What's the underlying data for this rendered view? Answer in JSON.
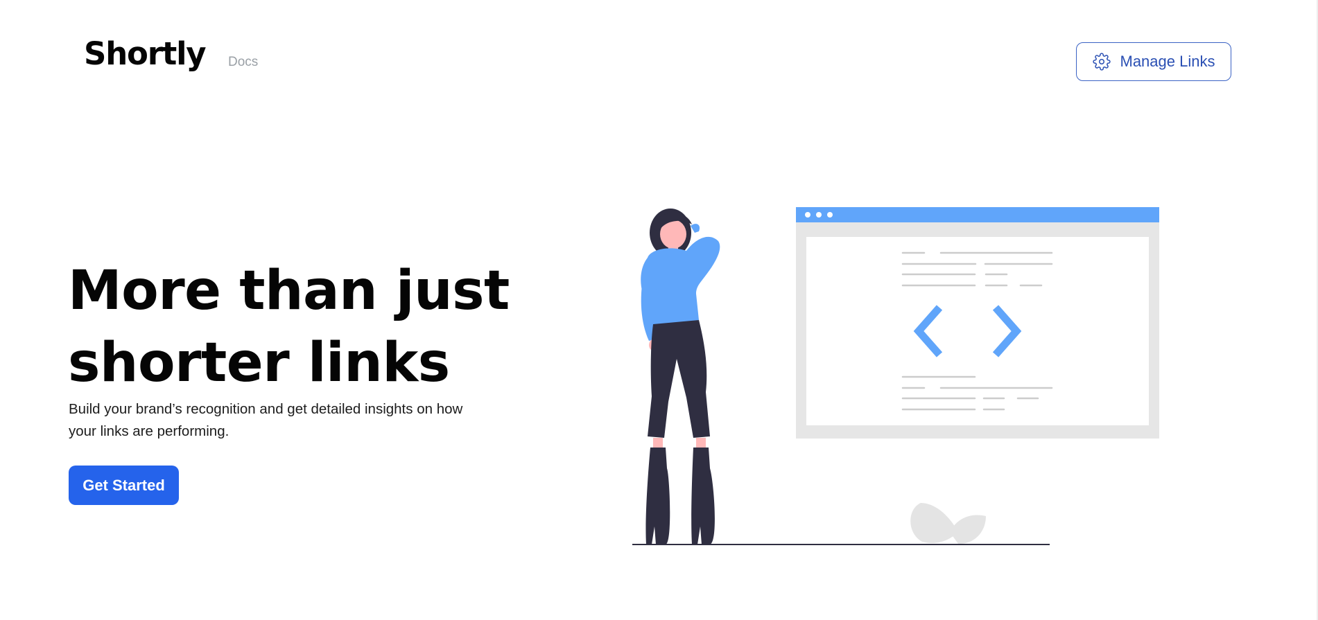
{
  "header": {
    "brand": "Shortly",
    "nav_docs": "Docs",
    "manage_links_label": "Manage Links"
  },
  "hero": {
    "title": "More than just shorter links",
    "subtitle": "Build your brand’s recognition and get detailed insights on how your links are performing.",
    "cta_label": "Get Started"
  },
  "icons": {
    "manage_links": "gear-icon"
  },
  "colors": {
    "primary": "#2563eb",
    "outline_button": "#3a62c4",
    "illustration_accent": "#60a5fa",
    "illustration_dark": "#2f2e41",
    "muted_text": "#9aa0a6"
  }
}
